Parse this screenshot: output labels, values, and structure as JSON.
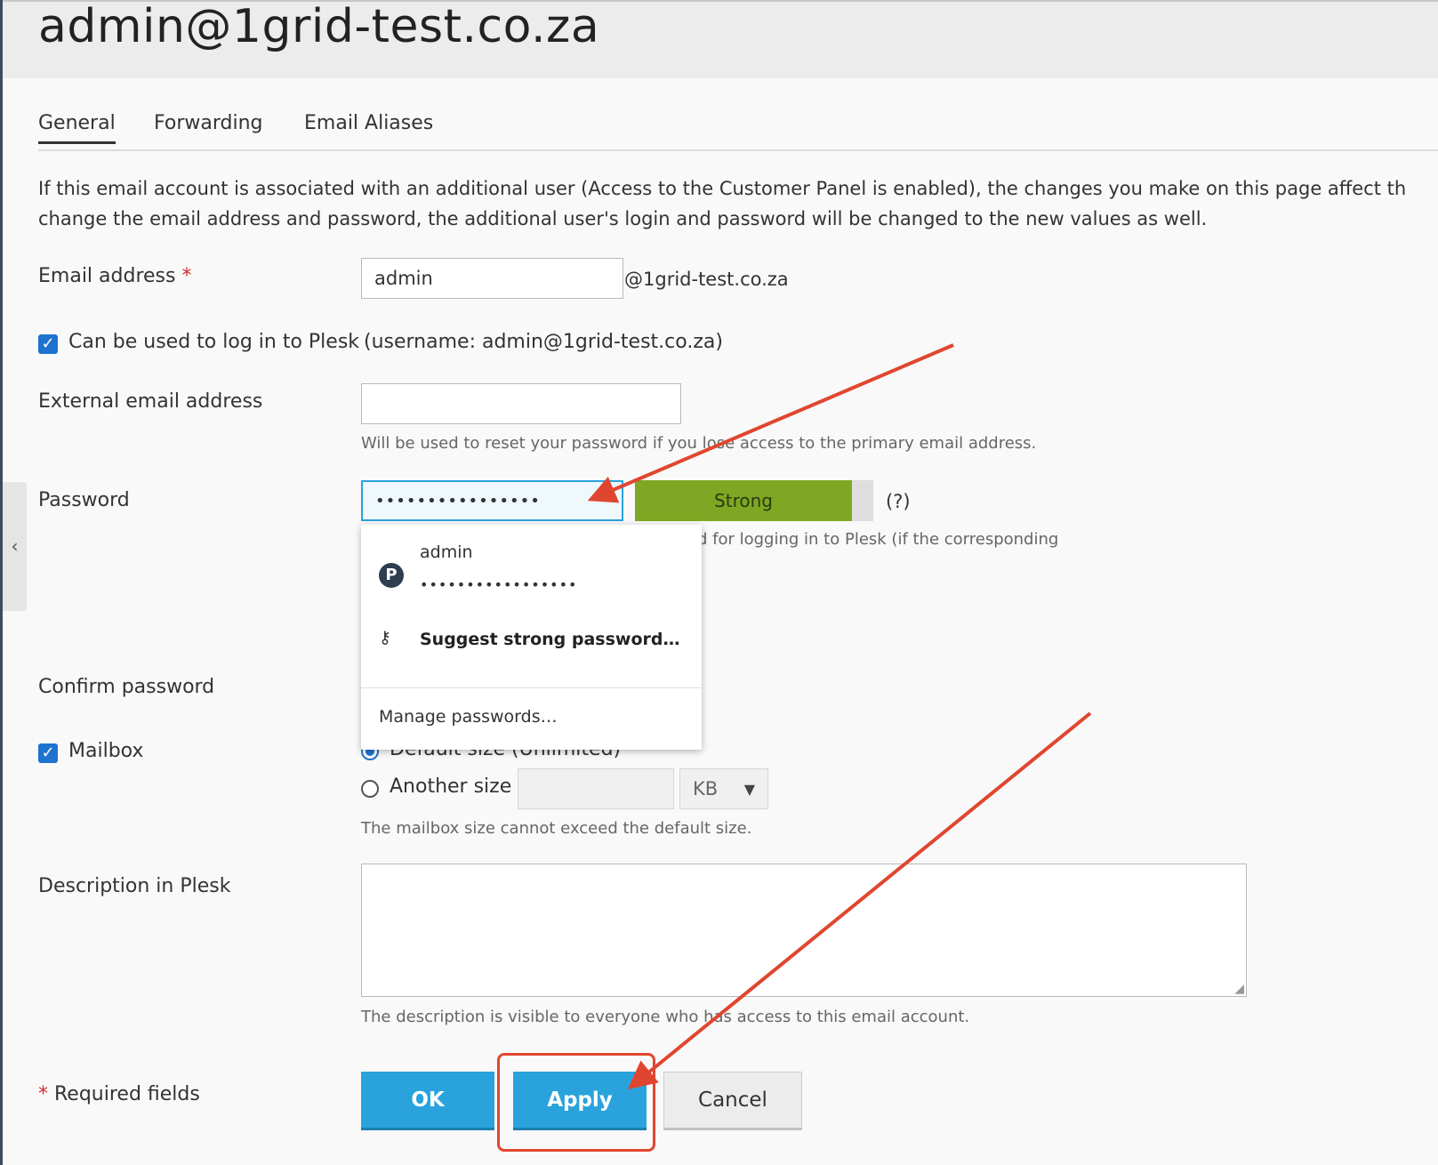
{
  "header": {
    "title": "admin@1grid-test.co.za"
  },
  "tabs": [
    {
      "label": "General",
      "active": true
    },
    {
      "label": "Forwarding",
      "active": false
    },
    {
      "label": "Email Aliases",
      "active": false
    }
  ],
  "intro": {
    "line1": "If this email account is associated with an additional user (Access to the Customer Panel is enabled), the changes you make on this page affect th",
    "line2": "change the email address and password, the additional user's login and password will be changed to the new values as well."
  },
  "email": {
    "label": "Email address",
    "required_mark": "*",
    "value": "admin",
    "domain_suffix": "@1grid-test.co.za"
  },
  "login": {
    "checked": true,
    "label": "Can be used to log in to Plesk",
    "note": "(username: admin@1grid-test.co.za)"
  },
  "external_email": {
    "label": "External email address",
    "value": "",
    "hint": "Will be used to reset your password if you lose access to the primary email address."
  },
  "password": {
    "label": "Password",
    "value": "••••••••••••••••",
    "strength_label": "Strong",
    "strength_fraction": 0.91,
    "help": "(?)",
    "hint_partial": "d for logging in to Plesk (if the corresponding",
    "colors": {
      "strong": "#7ea823",
      "focus": "#2aa3dc"
    }
  },
  "password_popup": {
    "saved_user": "admin",
    "saved_password": "•••••••••••••••••",
    "suggest_label": "Suggest strong password…",
    "manage_label": "Manage passwords…"
  },
  "confirm_password": {
    "label": "Confirm password"
  },
  "mailbox": {
    "checked": true,
    "label": "Mailbox",
    "default_option": "Default size (Unlimited)",
    "another_option": "Another size",
    "size_value": "",
    "unit": "KB",
    "hint": "The mailbox size cannot exceed the default size."
  },
  "description": {
    "label": "Description in Plesk",
    "value": "",
    "hint": "The description is visible to everyone who has access to this email account."
  },
  "footer": {
    "required_mark": "*",
    "required_text": "Required fields"
  },
  "buttons": {
    "ok": "OK",
    "apply": "Apply",
    "cancel": "Cancel"
  },
  "side_toggle": "‹",
  "annotation_color": "#e0462f"
}
